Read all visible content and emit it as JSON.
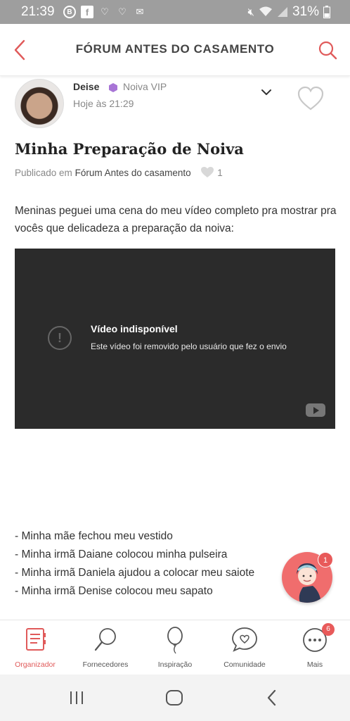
{
  "status_bar": {
    "time": "21:39",
    "battery": "31%",
    "icons": [
      "b-circle-icon",
      "facebook-icon",
      "heart-outline-icon",
      "heart-outline-icon",
      "mail-icon",
      "mute-icon",
      "wifi-icon",
      "signal-icon",
      "battery-icon"
    ]
  },
  "header": {
    "title": "FÓRUM ANTES DO CASAMENTO",
    "accent_color": "#e05a5a"
  },
  "post": {
    "author": "Deise",
    "badge": "Noiva VIP",
    "date": "Hoje às 21:29",
    "title": "Minha Preparação de Noiva",
    "published_prefix": "Publicado em",
    "forum": "Fórum Antes do casamento",
    "likes": "1",
    "body": "Meninas peguei uma cena do meu vídeo completo pra mostrar pra vocês que delicadeza a preparação da noiva:",
    "video": {
      "title": "Vídeo indisponível",
      "message": "Este vídeo foi removido pelo usuário que fez o envio"
    },
    "list": [
      "- Minha mãe fechou meu vestido",
      "- Minha irmã Daiane colocou minha pulseira",
      "- Minha irmã Daniela ajudou a colocar meu saiote",
      "- Minha irmã Denise colocou meu sapato"
    ]
  },
  "assistant": {
    "badge": "1"
  },
  "tabbar": {
    "items": [
      {
        "label": "Organizador",
        "icon": "planner-icon",
        "active": true
      },
      {
        "label": "Fornecedores",
        "icon": "search-icon",
        "active": false
      },
      {
        "label": "Inspiração",
        "icon": "balloon-icon",
        "active": false
      },
      {
        "label": "Comunidade",
        "icon": "chat-heart-icon",
        "active": false
      },
      {
        "label": "Mais",
        "icon": "more-icon",
        "active": false
      }
    ],
    "more_badge": "6"
  }
}
